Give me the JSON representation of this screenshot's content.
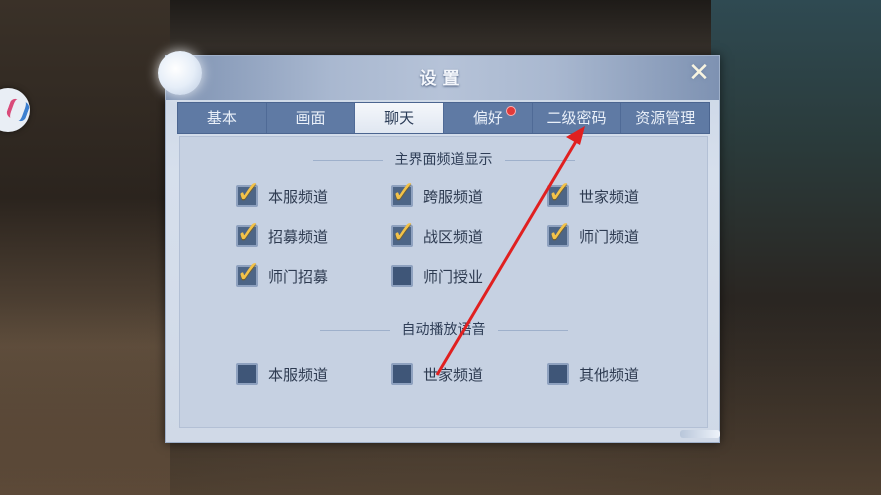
{
  "dialog": {
    "title": "设置",
    "close_glyph": "✕"
  },
  "tabs": [
    {
      "label": "基本",
      "active": false,
      "has_dot": false
    },
    {
      "label": "画面",
      "active": false,
      "has_dot": false
    },
    {
      "label": "聊天",
      "active": true,
      "has_dot": false
    },
    {
      "label": "偏好",
      "active": false,
      "has_dot": true
    },
    {
      "label": "二级密码",
      "active": false,
      "has_dot": false
    },
    {
      "label": "资源管理",
      "active": false,
      "has_dot": false
    }
  ],
  "section_channel_display": {
    "title": "主界面频道显示",
    "options": [
      {
        "label": "本服频道",
        "checked": true
      },
      {
        "label": "跨服频道",
        "checked": true
      },
      {
        "label": "世家频道",
        "checked": true
      },
      {
        "label": "招募频道",
        "checked": true
      },
      {
        "label": "战区频道",
        "checked": true
      },
      {
        "label": "师门频道",
        "checked": true
      },
      {
        "label": "师门招募",
        "checked": true
      },
      {
        "label": "师门授业",
        "checked": false
      }
    ]
  },
  "section_auto_voice": {
    "title": "自动播放语音",
    "options": [
      {
        "label": "本服频道",
        "checked": false
      },
      {
        "label": "世家频道",
        "checked": false
      },
      {
        "label": "其他频道",
        "checked": false
      }
    ]
  },
  "colors": {
    "arrow": "#e02020",
    "checkmark": "#f2c24a",
    "tab_bar": "#5f7aa4",
    "notification_dot": "#e23a3a"
  }
}
